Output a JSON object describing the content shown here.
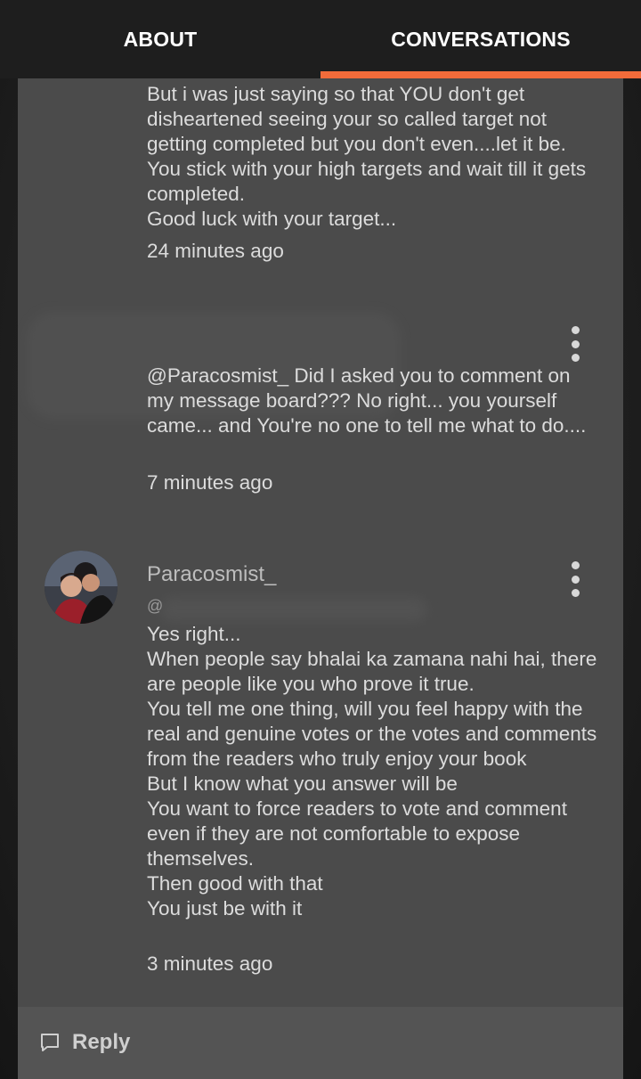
{
  "tabs": {
    "about": "ABOUT",
    "conversations": "CONVERSATIONS",
    "active": "conversations",
    "accent_color": "#f26b3a"
  },
  "messages": [
    {
      "text": "But i was just saying so that YOU don't get disheartened seeing your so called target not getting completed but you don't even....let it be. You stick with your high targets and wait till it gets completed.\nGood luck with your target...",
      "time": "24 minutes ago"
    },
    {
      "text": "@Paracosmist_ Did I asked you to comment on my message board??? No right... you yourself came... and You're no one to tell me what to do....",
      "time": "7 minutes ago",
      "menu_icon": "more-vertical-icon"
    },
    {
      "username": "Paracosmist_",
      "mention_prefix": "@",
      "text": "Yes right...\nWhen people say bhalai ka zamana nahi hai, there are people like you who prove it true.\nYou tell me one thing, will you feel happy with the real and genuine votes or the votes and comments from the readers who truly enjoy your book\nBut I know what you answer will be\nYou want to force readers to vote and comment even if they are not comfortable to expose themselves.\nThen good with that\nYou just be with it",
      "time": "3 minutes ago",
      "menu_icon": "more-vertical-icon",
      "avatar_icon": "user-avatar"
    }
  ],
  "reply": {
    "label": "Reply",
    "icon": "comment-icon"
  }
}
